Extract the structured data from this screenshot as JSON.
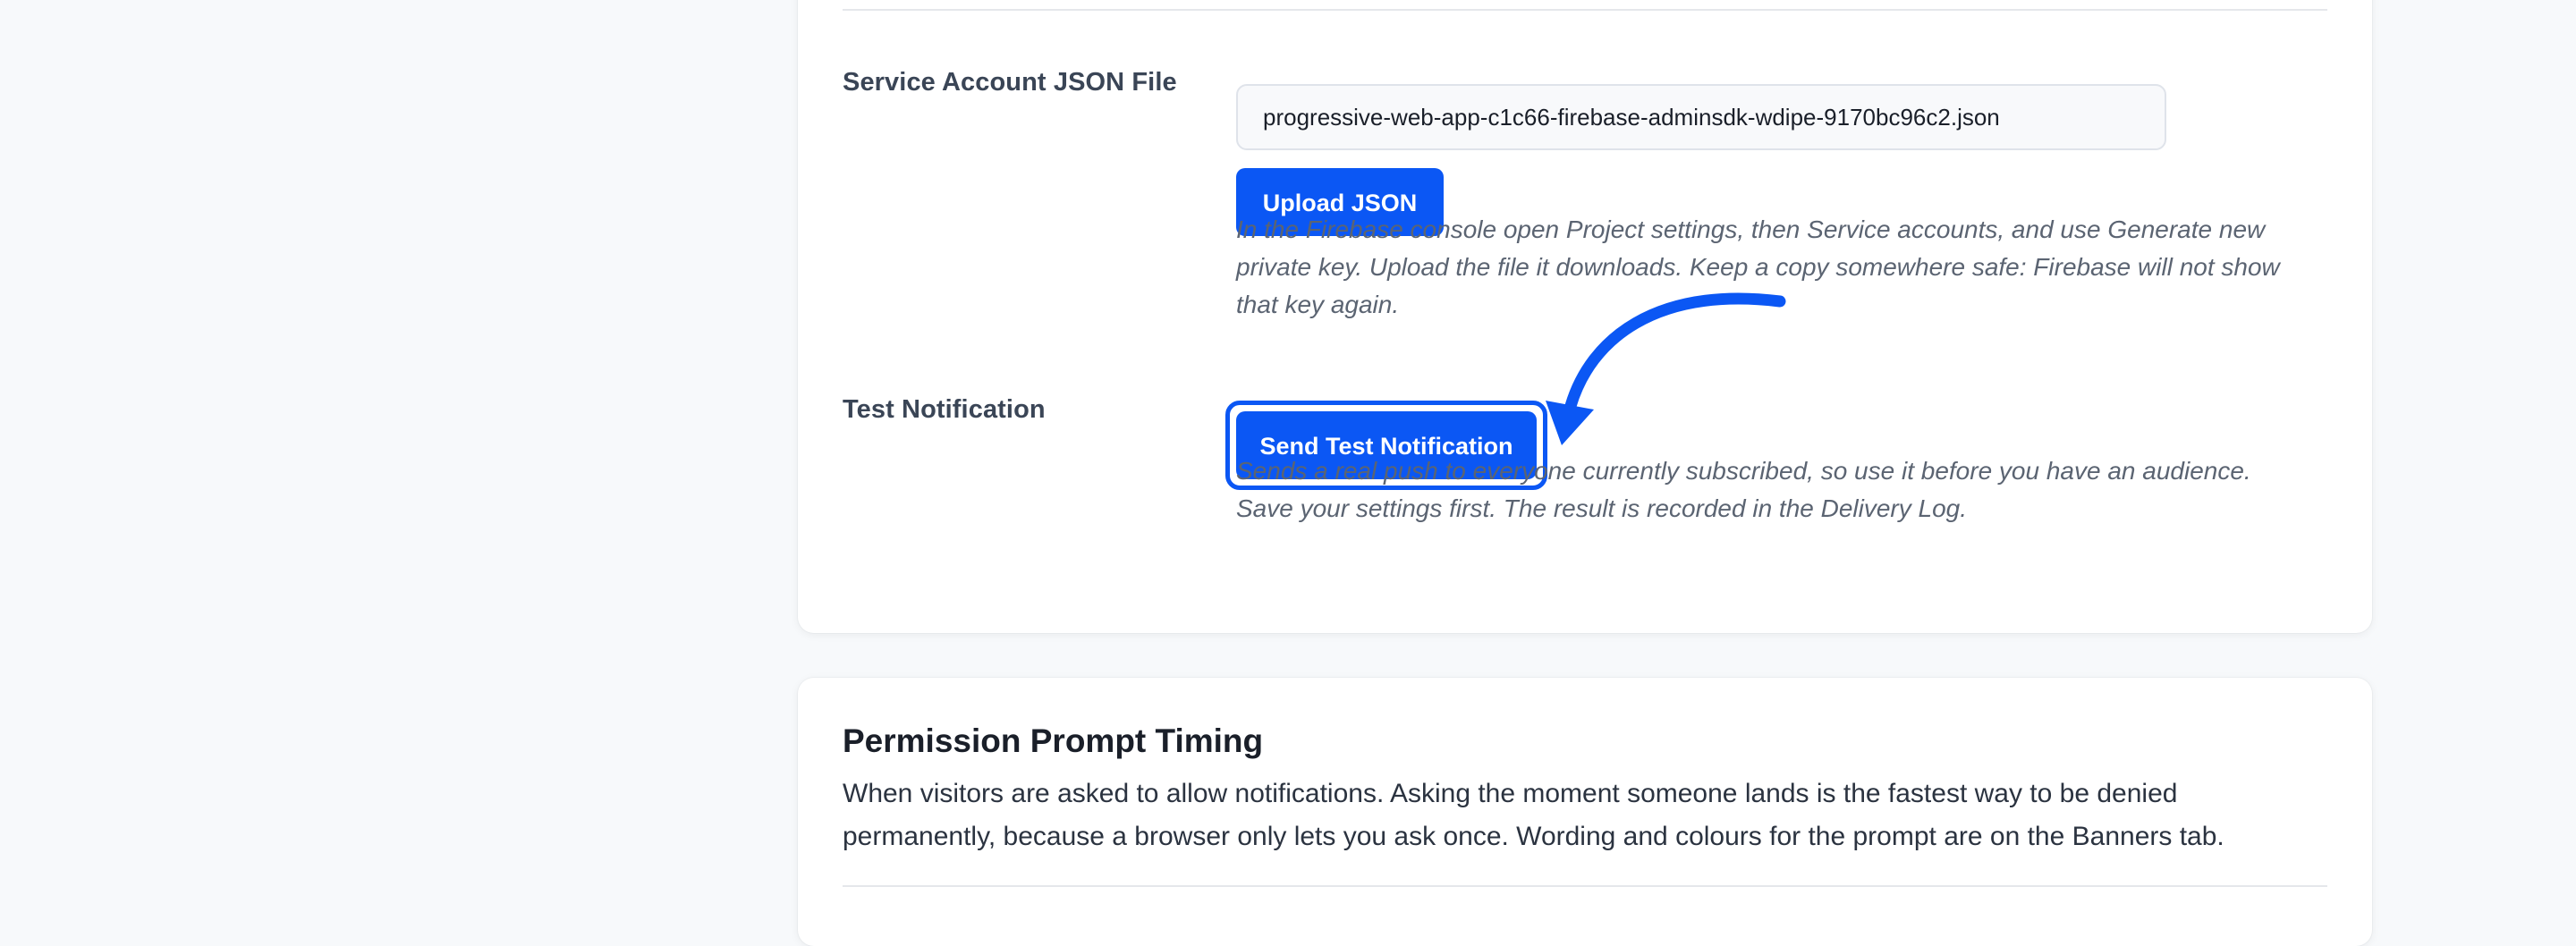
{
  "service_account": {
    "label": "Service Account JSON File",
    "file_value": "progressive-web-app-c1c66-firebase-adminsdk-wdipe-9170bc96c2.json",
    "upload_label": "Upload JSON",
    "help": "In the Firebase console open Project settings, then Service accounts, and use Generate new private key. Upload the file it downloads. Keep a copy somewhere safe: Firebase will not show that key again."
  },
  "test_notification": {
    "label": "Test Notification",
    "button_label": "Send Test Notification",
    "help": "Sends a real push to everyone currently subscribed, so use it before you have an audience. Save your settings first. The result is recorded in the Delivery Log."
  },
  "permission_prompt": {
    "title": "Permission Prompt Timing",
    "description": "When visitors are asked to allow notifications. Asking the moment someone lands is the fastest way to be denied permanently, because a browser only lets you ask once. Wording and colours for the prompt are on the Banners tab."
  },
  "colors": {
    "accent": "#0b57f4",
    "background": "#f7f9fb",
    "card": "#ffffff"
  },
  "icons": {
    "annotation": "curved-arrow-icon"
  }
}
